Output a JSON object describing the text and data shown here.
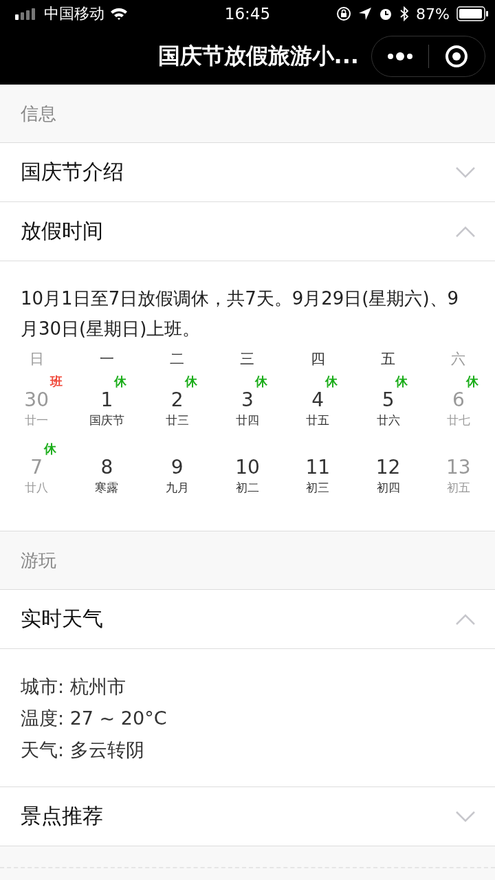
{
  "status_bar": {
    "carrier": "中国移动",
    "time": "16:45",
    "battery": "87%"
  },
  "nav": {
    "title": "国庆节放假旅游小..."
  },
  "sections": [
    {
      "label": "信息",
      "panels": [
        {
          "title": "国庆节介绍",
          "expanded": false
        },
        {
          "title": "放假时间",
          "expanded": true,
          "kind": "calendar",
          "text": "10月1日至7日放假调休，共7天。9月29日(星期六)、9月30日(星期日)上班。",
          "weekdays": [
            "日",
            "一",
            "二",
            "三",
            "四",
            "五",
            "六"
          ],
          "days": [
            {
              "day": "30",
              "lunar": "廿一",
              "muted": true,
              "tag": "班",
              "color": "#f0493b"
            },
            {
              "day": "1",
              "lunar": "国庆节",
              "muted": false,
              "tag": "休",
              "color": "#1aad19"
            },
            {
              "day": "2",
              "lunar": "廿三",
              "muted": false,
              "tag": "休",
              "color": "#1aad19"
            },
            {
              "day": "3",
              "lunar": "廿四",
              "muted": false,
              "tag": "休",
              "color": "#1aad19"
            },
            {
              "day": "4",
              "lunar": "廿五",
              "muted": false,
              "tag": "休",
              "color": "#1aad19"
            },
            {
              "day": "5",
              "lunar": "廿六",
              "muted": false,
              "tag": "休",
              "color": "#1aad19"
            },
            {
              "day": "6",
              "lunar": "廿七",
              "muted": true,
              "tag": "休",
              "color": "#1aad19"
            },
            {
              "day": "7",
              "lunar": "廿八",
              "muted": true,
              "tag": "休",
              "color": "#1aad19"
            },
            {
              "day": "8",
              "lunar": "寒露",
              "muted": false
            },
            {
              "day": "9",
              "lunar": "九月",
              "muted": false
            },
            {
              "day": "10",
              "lunar": "初二",
              "muted": false
            },
            {
              "day": "11",
              "lunar": "初三",
              "muted": false
            },
            {
              "day": "12",
              "lunar": "初四",
              "muted": false
            },
            {
              "day": "13",
              "lunar": "初五",
              "muted": true
            }
          ]
        }
      ]
    },
    {
      "label": "游玩",
      "panels": [
        {
          "title": "实时天气",
          "expanded": true,
          "kind": "lines",
          "lines": [
            "城市: 杭州市",
            "温度: 27 ~ 20°C",
            "天气: 多云转阴"
          ]
        },
        {
          "title": "景点推荐",
          "expanded": false
        }
      ]
    }
  ]
}
